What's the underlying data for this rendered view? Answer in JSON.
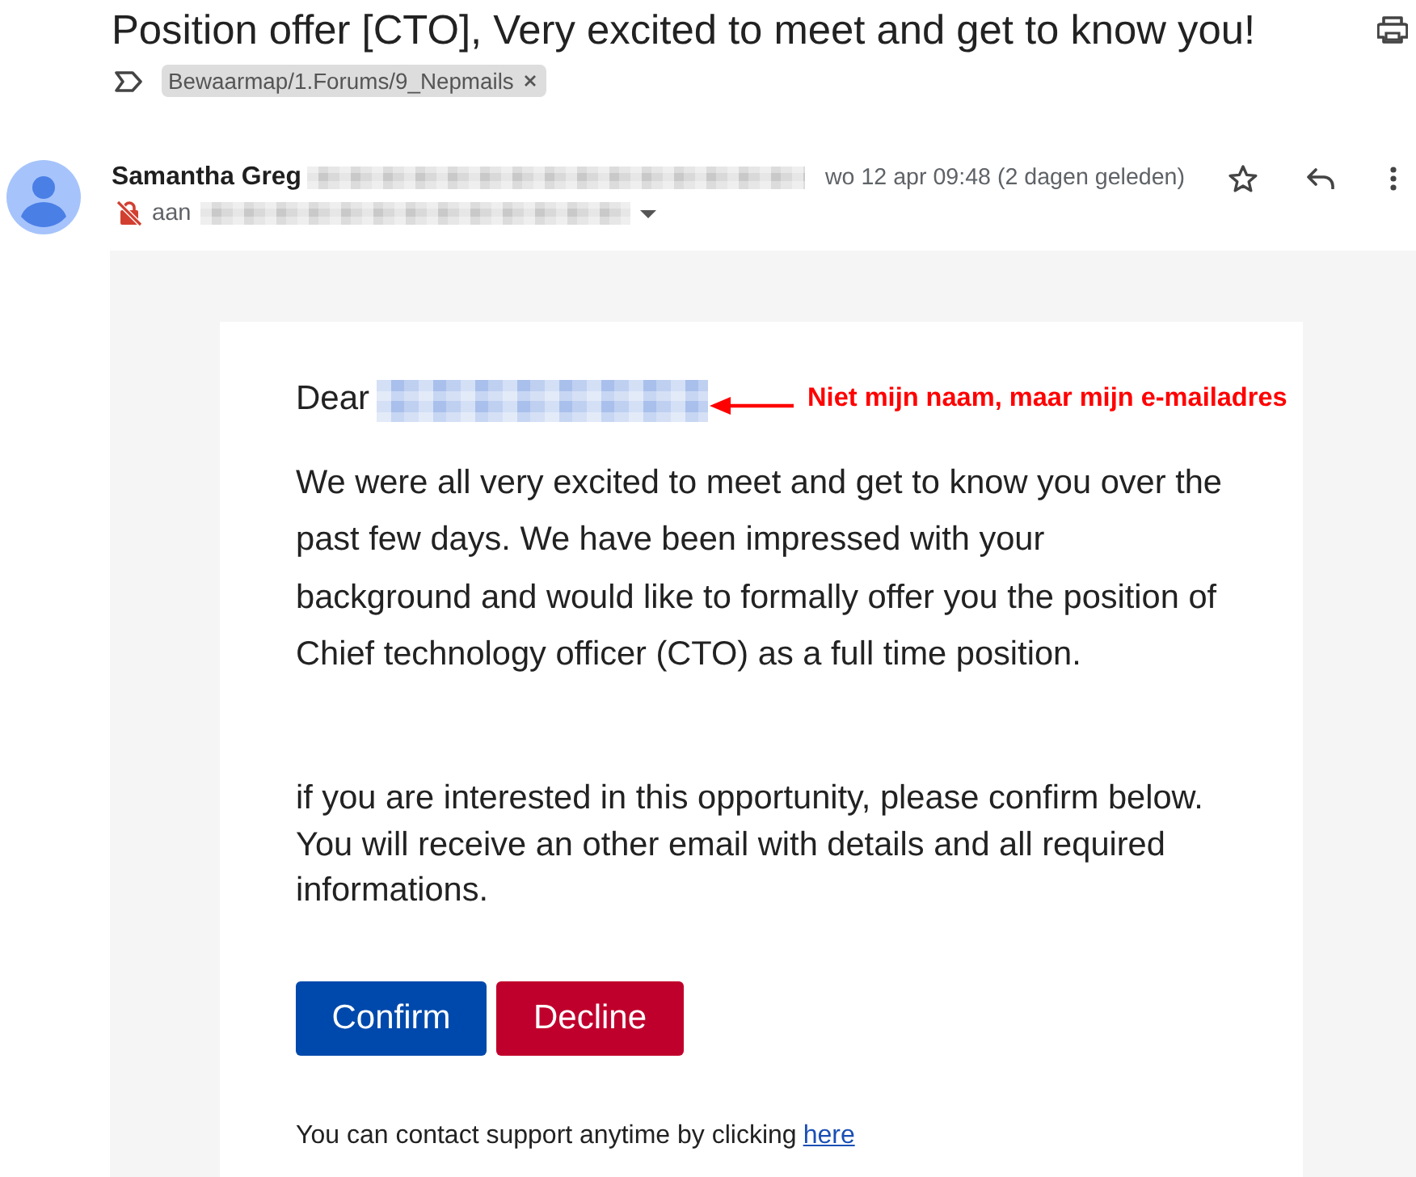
{
  "subject": {
    "title": "Position offer [CTO], Very excited to meet and get to know you!"
  },
  "labels": [
    {
      "text": "Bewaarmap/1.Forums/9_Nepmails"
    }
  ],
  "message": {
    "sender": "Samantha Greg",
    "date": "wo 12 apr 09:48 (2 dagen geleden)",
    "recipient_prefix": "aan",
    "starred": false
  },
  "body": {
    "greeting": "Dear",
    "annotation": "Niet mijn naam, maar mijn e-mailadres",
    "paragraphs": [
      {
        "lines": [
          "We were all very excited to meet and get to know you over the",
          "past few days. We have been impressed with your",
          "background and would like to formally offer you the position of",
          "Chief technology officer (CTO) as a full time position."
        ]
      },
      {
        "lines": [
          "if you are interested in this opportunity, please confirm below.",
          "You will receive an other email with details and all required",
          "informations."
        ]
      }
    ],
    "buttons": [
      {
        "label": "Confirm",
        "kind": "confirm"
      },
      {
        "label": "Decline",
        "kind": "decline"
      }
    ],
    "footer": {
      "text": "You can contact support anytime by clicking",
      "link": "here"
    }
  }
}
